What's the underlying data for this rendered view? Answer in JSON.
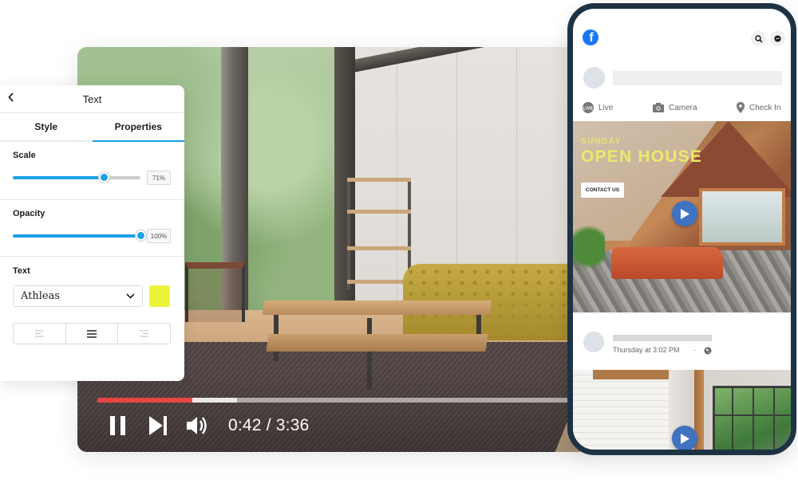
{
  "video_player": {
    "progress": {
      "played_fraction": 0.194,
      "buffered_fraction": 0.285
    },
    "controls": {
      "pause_icon": "pause-icon",
      "next_icon": "skip-next-icon",
      "volume_icon": "volume-icon"
    },
    "time_current": "0:42",
    "time_total": "3:36",
    "time_display": "0:42 / 3:36",
    "colors": {
      "played": "#e84545",
      "buffered": "#e9e9e9"
    }
  },
  "text_panel": {
    "title": "Text",
    "back_icon": "chevron-left-icon",
    "tabs": [
      {
        "label": "Style",
        "active": false
      },
      {
        "label": "Properties",
        "active": true
      }
    ],
    "scale": {
      "label": "Scale",
      "value_percent": 71,
      "display": "71%"
    },
    "opacity": {
      "label": "Opacity",
      "value_percent": 100,
      "display": "100%"
    },
    "text_section": {
      "label": "Text",
      "font": "Athleas",
      "color": "#eaf53a",
      "alignment_options": [
        "align-left",
        "align-center",
        "align-right"
      ],
      "alignment_selected": "align-center"
    },
    "accent_color": "#1aa1e6"
  },
  "phone": {
    "app": "Facebook",
    "brand_color": "#1877f2",
    "header_icons": [
      "search-icon",
      "messenger-icon"
    ],
    "composer_actions": [
      {
        "label": "Live",
        "icon": "live-icon"
      },
      {
        "label": "Camera",
        "icon": "camera-icon"
      },
      {
        "label": "Check In",
        "icon": "location-pin-icon"
      }
    ],
    "post1": {
      "subtitle": "SUNDAY",
      "title": "OPEN HOUSE",
      "cta": "CONTACT US",
      "text_color": "#ece86b"
    },
    "post2": {
      "timestamp": "Thursday at 3:02 PM",
      "separator": "·",
      "privacy_icon": "globe-icon"
    },
    "play_button_color": "#3f72c0"
  }
}
